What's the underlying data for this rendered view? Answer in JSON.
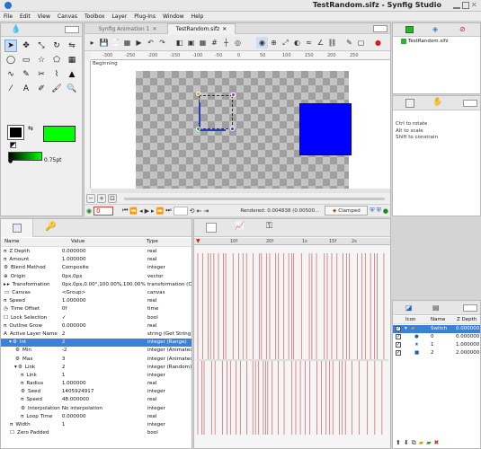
{
  "window": {
    "title": "TestRandom.sifz - Synfig Studio"
  },
  "menu": [
    "File",
    "Edit",
    "View",
    "Canvas",
    "Toolbox",
    "Layer",
    "Plug-Ins",
    "Window",
    "Help"
  ],
  "tabs": [
    {
      "label": "Synfig Animation 1"
    },
    {
      "label": "TestRandom.sifz"
    }
  ],
  "ruler": {
    "top_ticks": [
      "-300",
      "-250",
      "-200",
      "-150",
      "-100",
      "-50",
      "0",
      "50",
      "100",
      "150",
      "200",
      "250"
    ]
  },
  "canvas": {
    "keyframe_label": "Beginning",
    "blue_color": "#0000ff",
    "green_color": "#00e400"
  },
  "toolbox": {
    "outline_width": "0.75pt",
    "outline_color": "#000000",
    "fill_color": "#00ff00"
  },
  "canvas_footer": {
    "time": "0",
    "render_status": "Rendered: 0.004838 (0.00500...",
    "interp_label": "Clamped"
  },
  "library": {
    "file": "TestRandom.sifz"
  },
  "tool_options": {
    "lines": [
      "Ctrl to rotate",
      "Alt to scale",
      "Shift to constrain"
    ]
  },
  "params": {
    "headers": {
      "name": "Name",
      "value": "Value",
      "type": "Type"
    },
    "rows": [
      {
        "icon": "π",
        "name": "Z Depth",
        "value": "0.000000",
        "type": "real",
        "indent": 0
      },
      {
        "icon": "π",
        "name": "Amount",
        "value": "1.000000",
        "type": "real",
        "indent": 0
      },
      {
        "icon": "⚙",
        "name": "Blend Method",
        "value": "Composite",
        "type": "integer",
        "indent": 0
      },
      {
        "icon": "⊕",
        "name": "Origin",
        "value": "0px,0px",
        "type": "vector",
        "indent": 0
      },
      {
        "icon": "▸",
        "name": "Transformation",
        "value": "0px,0px,0.00°,100.00%,100.00%",
        "type": "transformation (Composite)",
        "indent": 0
      },
      {
        "icon": "▭",
        "name": "Canvas",
        "value": "<Group>",
        "type": "canvas",
        "indent": 0
      },
      {
        "icon": "π",
        "name": "Speed",
        "value": "1.000000",
        "type": "real",
        "indent": 0
      },
      {
        "icon": "◷",
        "name": "Time Offset",
        "value": "0f",
        "type": "time",
        "indent": 0
      },
      {
        "icon": "☐",
        "name": "Lock Selection",
        "value": "✓",
        "type": "bool",
        "indent": 0
      },
      {
        "icon": "π",
        "name": "Outline Grow",
        "value": "0.000000",
        "type": "real",
        "indent": 0
      },
      {
        "icon": "A",
        "name": "Active Layer Name",
        "value": "2",
        "type": "string (Get String)",
        "indent": 0
      },
      {
        "icon": "⚙",
        "name": "Int",
        "value": "2",
        "type": "integer (Range)",
        "indent": 1,
        "selected": true
      },
      {
        "icon": "⚙",
        "name": "Min",
        "value": "-2",
        "type": "integer (Animated)",
        "indent": 2
      },
      {
        "icon": "⚙",
        "name": "Max",
        "value": "3",
        "type": "integer (Animated)",
        "indent": 2
      },
      {
        "icon": "⚙",
        "name": "Link",
        "value": "2",
        "type": "integer (Random)",
        "indent": 2
      },
      {
        "icon": "π",
        "name": "Link",
        "value": "1",
        "type": "integer",
        "indent": 3
      },
      {
        "icon": "π",
        "name": "Radius",
        "value": "1.000000",
        "type": "real",
        "indent": 3
      },
      {
        "icon": "⚙",
        "name": "Seed",
        "value": "1405924917",
        "type": "integer",
        "indent": 3
      },
      {
        "icon": "π",
        "name": "Speed",
        "value": "48.000000",
        "type": "real",
        "indent": 3
      },
      {
        "icon": "⚙",
        "name": "Interpolation",
        "value": "No interpolation",
        "type": "integer",
        "indent": 3
      },
      {
        "icon": "π",
        "name": "Loop Time",
        "value": "0.000000",
        "type": "real",
        "indent": 3
      },
      {
        "icon": "π",
        "name": "Width",
        "value": "1",
        "type": "integer",
        "indent": 1
      },
      {
        "icon": "☐",
        "name": "Zero Padded",
        "value": "",
        "type": "bool",
        "indent": 1
      }
    ]
  },
  "timetrack": {
    "ruler_labels": [
      "10f",
      "20f",
      "1s",
      "15f",
      "2s"
    ]
  },
  "layers": {
    "headers": {
      "icon": "Icon",
      "name": "Name",
      "zdepth": "Z Depth"
    },
    "rows": [
      {
        "name": "Switch",
        "zdepth": "0.000000",
        "icon": "folder",
        "indent": 0,
        "selected": true
      },
      {
        "name": "0",
        "zdepth": "0.000000",
        "icon": "circle",
        "indent": 1
      },
      {
        "name": "1",
        "zdepth": "1.000000",
        "icon": "star",
        "indent": 1
      },
      {
        "name": "2",
        "zdepth": "2.000000",
        "icon": "square",
        "indent": 1
      }
    ]
  }
}
